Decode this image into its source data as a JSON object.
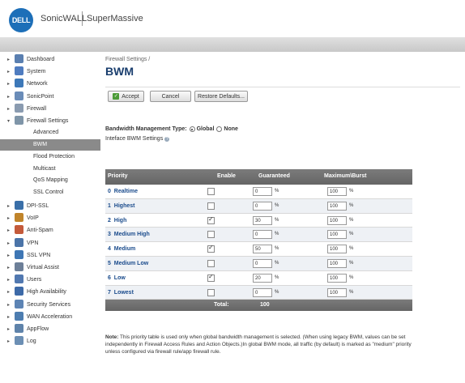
{
  "header": {
    "logo": "DELL",
    "brand": "SonicWALL",
    "product": "SuperMassive"
  },
  "colors": {
    "accent": "#1a3e6e",
    "link": "#1a4b8c",
    "active_nav": "#8a8a8a",
    "table_header": "#6e6e6e"
  },
  "sidebar": {
    "items": [
      {
        "label": "Dashboard",
        "icon": "dashboard-icon"
      },
      {
        "label": "System",
        "icon": "system-icon"
      },
      {
        "label": "Network",
        "icon": "network-icon"
      },
      {
        "label": "SonicPoint",
        "icon": "sonicpoint-icon"
      },
      {
        "label": "Firewall",
        "icon": "firewall-icon"
      },
      {
        "label": "Firewall Settings",
        "icon": "firewall-settings-icon"
      }
    ],
    "subitems": [
      {
        "label": "Advanced"
      },
      {
        "label": "BWM"
      },
      {
        "label": "Flood Protection"
      },
      {
        "label": "Multicast"
      },
      {
        "label": "QoS Mapping"
      },
      {
        "label": "SSL Control"
      }
    ],
    "items2": [
      {
        "label": "DPI-SSL",
        "icon": "dpi-ssl-icon"
      },
      {
        "label": "VoIP",
        "icon": "voip-icon"
      },
      {
        "label": "Anti-Spam",
        "icon": "anti-spam-icon"
      },
      {
        "label": "VPN",
        "icon": "vpn-icon"
      },
      {
        "label": "SSL VPN",
        "icon": "ssl-vpn-icon"
      },
      {
        "label": "Virtual Assist",
        "icon": "virtual-assist-icon"
      },
      {
        "label": "Users",
        "icon": "users-icon"
      },
      {
        "label": "High Availability",
        "icon": "high-availability-icon"
      },
      {
        "label": "Security Services",
        "icon": "security-services-icon"
      },
      {
        "label": "WAN Acceleration",
        "icon": "wan-acceleration-icon"
      },
      {
        "label": "AppFlow",
        "icon": "appflow-icon"
      },
      {
        "label": "Log",
        "icon": "log-icon"
      }
    ]
  },
  "main": {
    "breadcrumb": "Firewall Settings /",
    "title": "BWM",
    "buttons": {
      "accept": "Accept",
      "cancel": "Cancel",
      "restore": "Restore Defaults..."
    },
    "bwm_type_label": "Bandwidth Management Type:",
    "global_label": "Global",
    "none_label": "None",
    "interface_label": "Inteface BWM Settings",
    "table": {
      "headers": {
        "priority": "Priority",
        "enable": "Enable",
        "guaranteed": "Guaranteed",
        "max": "Maximum\\Burst"
      },
      "rows": [
        {
          "num": "0",
          "name": "Realtime",
          "enabled": false,
          "guaranteed": "0",
          "max": "100"
        },
        {
          "num": "1",
          "name": "Highest",
          "enabled": false,
          "guaranteed": "0",
          "max": "100"
        },
        {
          "num": "2",
          "name": "High",
          "enabled": true,
          "guaranteed": "30",
          "max": "100"
        },
        {
          "num": "3",
          "name": "Medium High",
          "enabled": false,
          "guaranteed": "0",
          "max": "100"
        },
        {
          "num": "4",
          "name": "Medium",
          "enabled": true,
          "guaranteed": "50",
          "max": "100"
        },
        {
          "num": "5",
          "name": "Medium Low",
          "enabled": false,
          "guaranteed": "0",
          "max": "100"
        },
        {
          "num": "6",
          "name": "Low",
          "enabled": true,
          "guaranteed": "20",
          "max": "100"
        },
        {
          "num": "7",
          "name": "Lowest",
          "enabled": false,
          "guaranteed": "0",
          "max": "100"
        }
      ],
      "pct": "%",
      "total_label": "Total:",
      "total_value": "100"
    },
    "note_bold": "Note:",
    "note": "This priority table is used only when global bandwidth management is selected. (When using legacy BWM, values can be set independently in Firewall Access Rules and Action Objects.)In global BWM mode, all traffic (by default) is marked as \"medium\" priority unless configured via firewall rule/app firewall rule."
  }
}
